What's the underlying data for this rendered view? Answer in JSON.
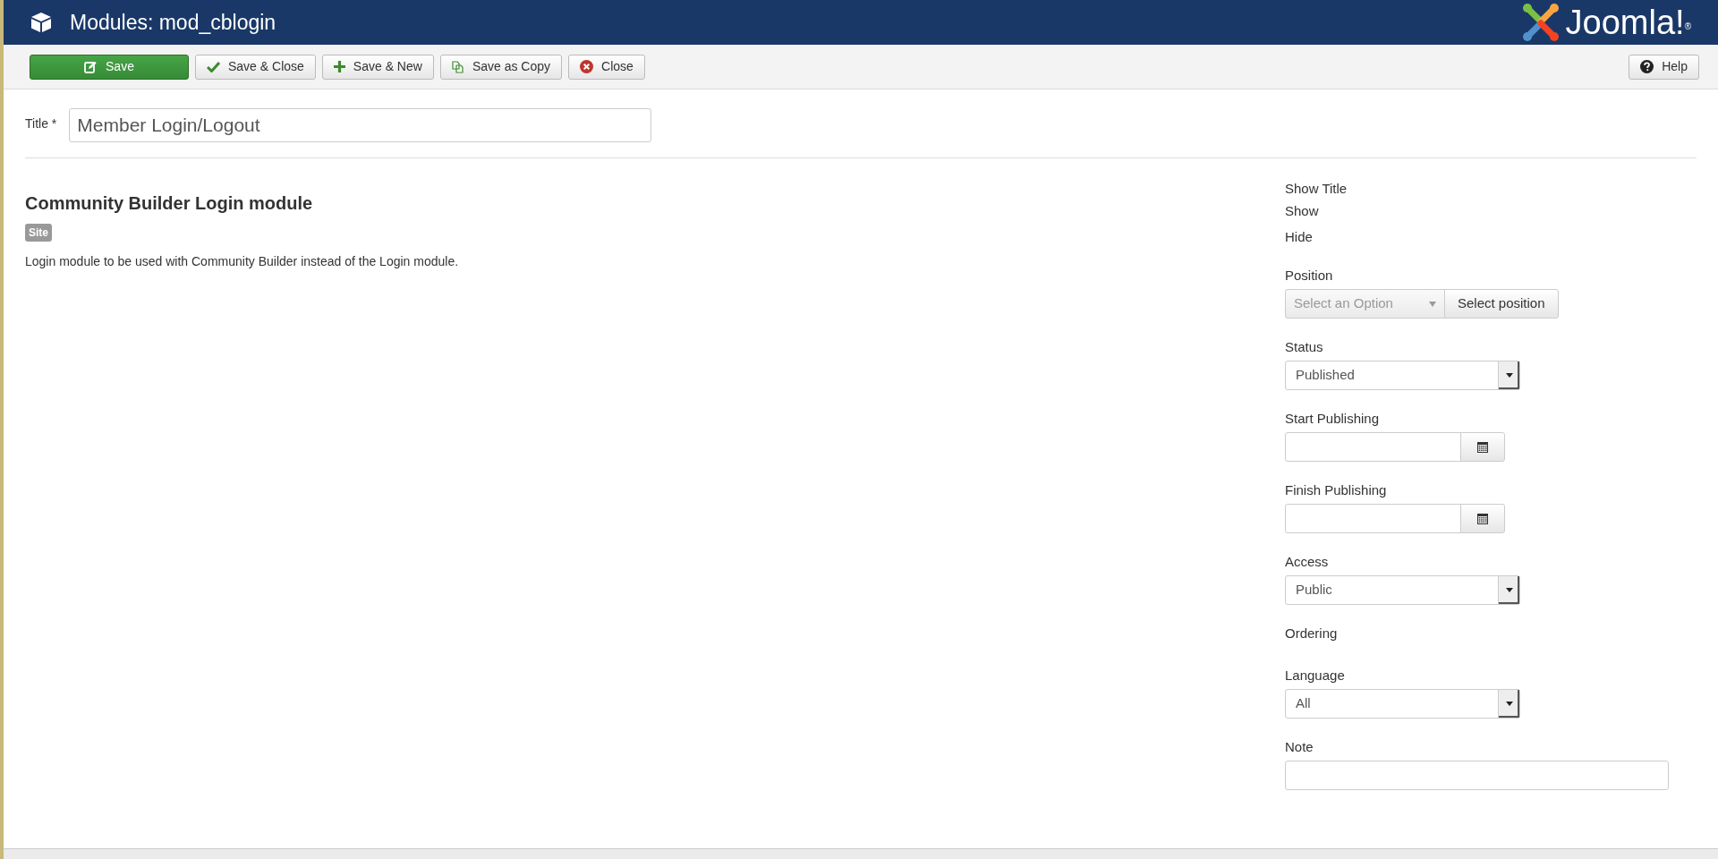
{
  "header": {
    "title": "Modules: mod_cblogin",
    "brand": "Joomla!",
    "brand_mark": "®"
  },
  "toolbar": {
    "buttons": [
      {
        "label": "Save",
        "kind": "save"
      },
      {
        "label": "Save & Close",
        "kind": "check"
      },
      {
        "label": "Save & New",
        "kind": "plus"
      },
      {
        "label": "Save as Copy",
        "kind": "copy"
      },
      {
        "label": "Close",
        "kind": "close"
      }
    ],
    "help": "Help"
  },
  "title_field": {
    "label": "Title *",
    "value": "Member Login/Logout"
  },
  "module": {
    "heading": "Community Builder Login module",
    "badge": "Site",
    "description": "Login module to be used with Community Builder instead of the Login module."
  },
  "fields": [
    {
      "kind": "options",
      "label": "Show Title",
      "options": [
        "Show",
        "Hide"
      ]
    },
    {
      "kind": "position",
      "label": "Position",
      "placeholder": "Select an Option",
      "button": "Select position"
    },
    {
      "kind": "select",
      "label": "Status",
      "value": "Published"
    },
    {
      "kind": "calendar",
      "label": "Start Publishing"
    },
    {
      "kind": "calendar",
      "label": "Finish Publishing"
    },
    {
      "kind": "select",
      "label": "Access",
      "value": "Public"
    },
    {
      "kind": "label",
      "label": "Ordering"
    },
    {
      "kind": "select",
      "label": "Language",
      "value": "All"
    },
    {
      "kind": "text",
      "label": "Note"
    }
  ]
}
